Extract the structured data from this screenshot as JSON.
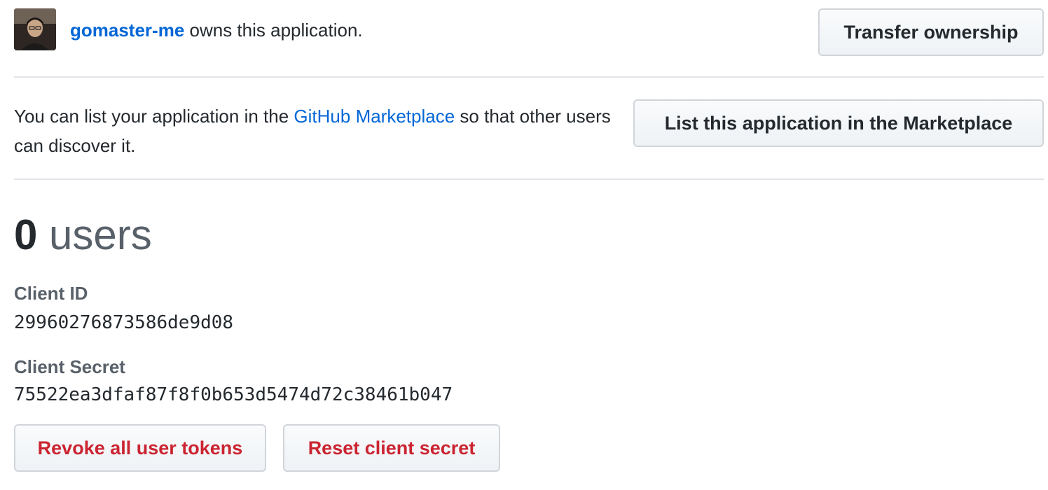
{
  "owner": {
    "username": "gomaster-me",
    "suffix": " owns this application.",
    "transfer_label": "Transfer ownership"
  },
  "marketplace": {
    "text_before": "You can list your application in the ",
    "link_label": "GitHub Marketplace",
    "text_after": " so that other users can discover it.",
    "button_label": "List this application in the Marketplace"
  },
  "users": {
    "count": "0",
    "label": " users"
  },
  "client_id": {
    "label": "Client ID",
    "value": "29960276873586de9d08"
  },
  "client_secret": {
    "label": "Client Secret",
    "value": "75522ea3dfaf87f8f0b653d5474d72c38461b047"
  },
  "actions": {
    "revoke_label": "Revoke all user tokens",
    "reset_label": "Reset client secret"
  },
  "colors": {
    "link": "#0366d6",
    "danger": "#cb2431",
    "muted": "#586069"
  }
}
